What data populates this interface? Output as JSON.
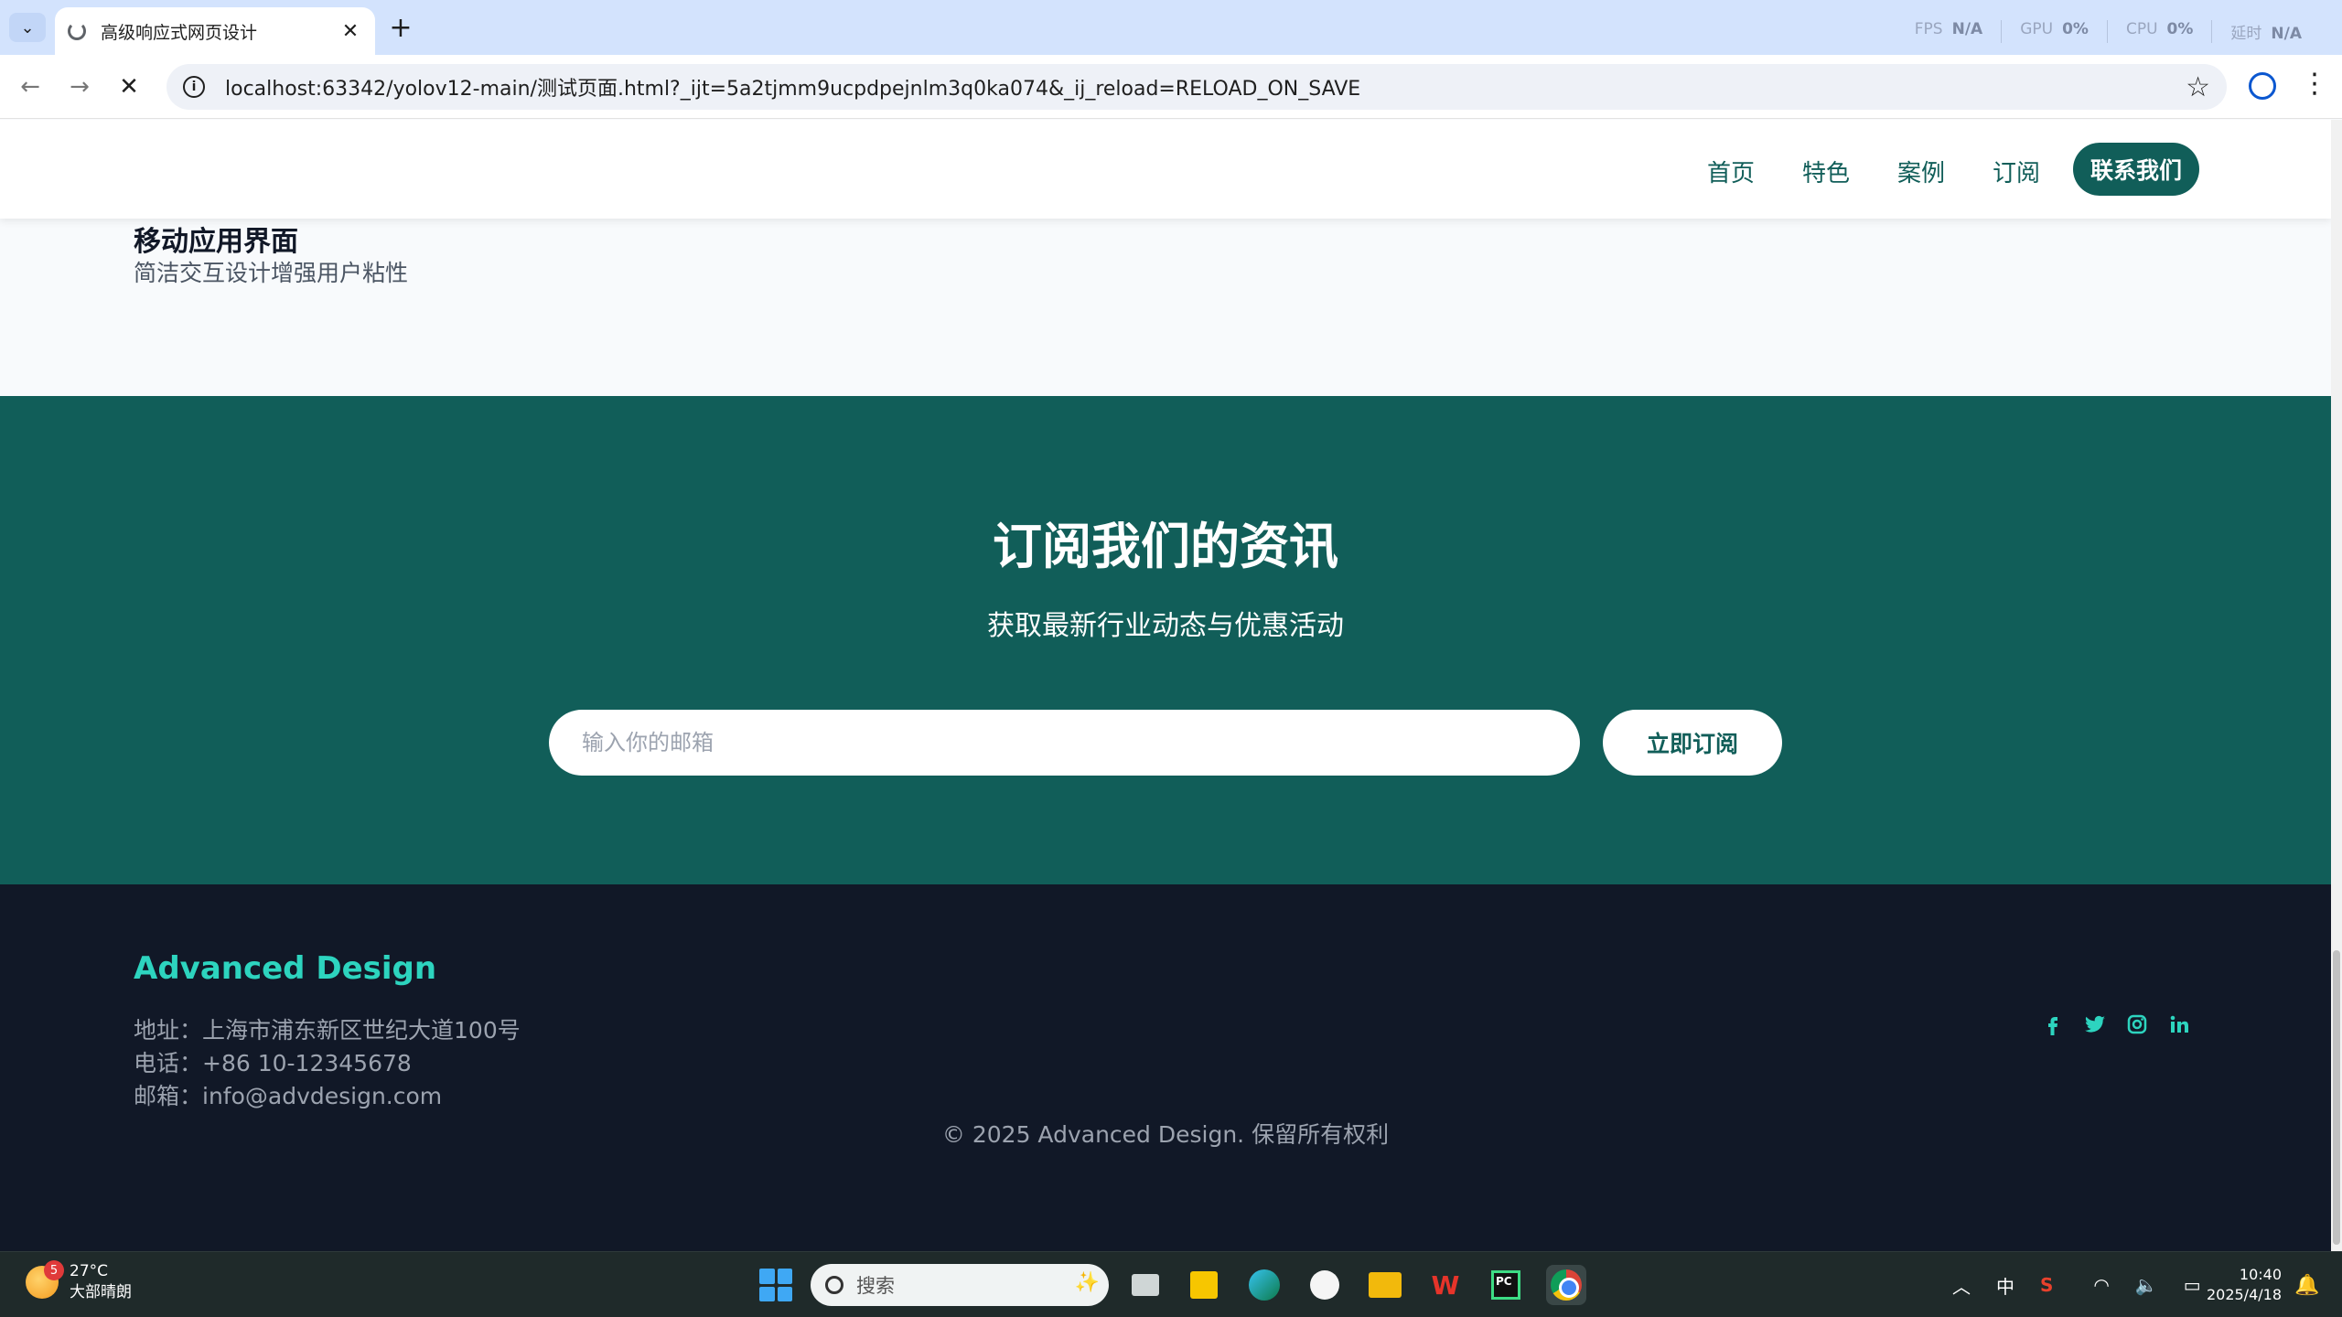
{
  "browser": {
    "tab_title": "高级响应式网页设计",
    "tab_close": "✕",
    "new_tab": "+",
    "dropdown": "⌄",
    "url": "localhost:63342/yolov12-main/测试页面.html?_ijt=5a2tjmm9ucpdpejnlm3q0ka074&_ij_reload=RELOAD_ON_SAVE",
    "perf": [
      {
        "label": "FPS",
        "value": "N/A"
      },
      {
        "label": "GPU",
        "value": "0%"
      },
      {
        "label": "CPU",
        "value": "0%"
      },
      {
        "label": "延时",
        "value": "N/A"
      }
    ]
  },
  "header": {
    "nav": [
      "首页",
      "特色",
      "案例",
      "订阅"
    ],
    "contact": "联系我们"
  },
  "case": {
    "title": "移动应用界面",
    "desc": "简洁交互设计增强用户粘性"
  },
  "subscribe": {
    "title": "订阅我们的资讯",
    "desc": "获取最新行业动态与优惠活动",
    "placeholder": "输入你的邮箱",
    "button": "立即订阅"
  },
  "footer": {
    "brand": "Advanced Design",
    "address": "地址：上海市浦东新区世纪大道100号",
    "phone": "电话：+86 10-12345678",
    "email": "邮箱：info@advdesign.com",
    "copyright": "© 2025 Advanced Design. 保留所有权利"
  },
  "taskbar": {
    "temp": "27°C",
    "weather": "大部晴朗",
    "weather_badge": "5",
    "search": "搜索",
    "ime": "中",
    "time": "10:40",
    "date": "2025/4/18"
  },
  "colors": {
    "brand": "#115e59",
    "accent": "#2dd4bf",
    "footer_bg": "#111827"
  }
}
